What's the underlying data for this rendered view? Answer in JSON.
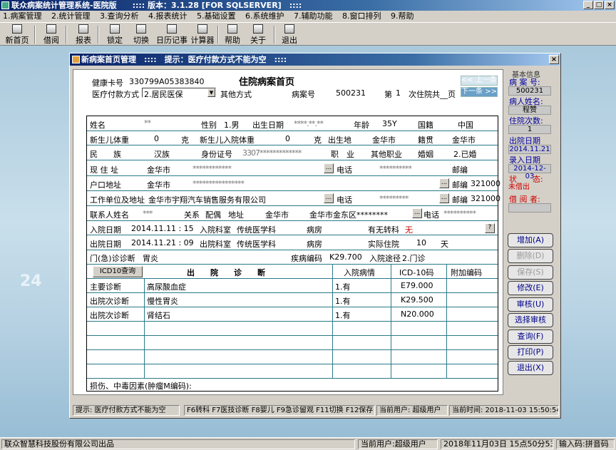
{
  "window": {
    "title": "联众病案统计管理系统-医院版　　:::: 版本：3.1.28 [FOR SQLSERVER]　::::"
  },
  "menu": [
    "1.病案管理",
    "2.统计管理",
    "3.查询分析",
    "4.报表统计",
    "5.基础设置",
    "6.系统维护",
    "7.辅助功能",
    "8.窗口排列",
    "9.帮助"
  ],
  "toolbar": [
    "新首页",
    "借阅",
    "报表",
    "锁定",
    "切换",
    "日历记事",
    "计算器",
    "帮助",
    "关于",
    "退出"
  ],
  "dialog": {
    "title": "新病案首页管理　::::　提示：医疗付款方式不能为空　::::",
    "close": "×",
    "health_card_label": "健康卡号",
    "health_card": "330799A05383840",
    "doc_title": "住院病案首页",
    "prev_btn": "<< 上一条",
    "next_btn": "下一条 >>",
    "pay_label": "医疗付款方式",
    "pay_value": "2.居民医保",
    "other_way_label": "其他方式",
    "case_no_label": "病案号",
    "case_no": "500231",
    "times_label": "第",
    "times": "1",
    "times_suffix": "次住院共__页",
    "name_label": "姓名",
    "name_value": "**",
    "sex_label": "性别",
    "sex_value": "1.男",
    "birth_label": "出生日期",
    "birth_value": "****.**.**",
    "age_label": "年龄",
    "age_value": "35Y",
    "nation_label": "国籍",
    "nation_value": "中国",
    "baby_weight_label": "新生儿体重",
    "baby_weight": "0",
    "unit_g": "克",
    "baby_in_weight_label": "新生儿入院体重",
    "baby_in_weight": "0",
    "unit_g2": "克",
    "birthplace_label": "出生地",
    "birthplace": "金华市",
    "native_label": "籍贯",
    "native": "金华市",
    "ethnic_label": "民　　族",
    "ethnic": "汉族",
    "id_label": "身份证号",
    "id_value": "3307*************",
    "job_label": "职　业",
    "job": "其他职业",
    "marriage_label": "婚姻",
    "marriage": "2.已婚",
    "cur_addr_label": "现 住 址",
    "cur_addr": "金华市",
    "cur_addr_blur": "************",
    "phone_label": "电话",
    "phone_blur": "**********",
    "zip_label": "邮编",
    "hukou_label": "户口地址",
    "hukou": "金华市",
    "hukou_blur": "****************",
    "zip_label2": "邮编",
    "zip2": "321000",
    "work_label": "工作单位及地址",
    "work": "金华市宇翔汽车销售服务有限公司",
    "phone_label2": "电话",
    "phone2_blur": "*********",
    "zip_label3": "邮编",
    "zip3": "321000",
    "contact_label": "联系人姓名",
    "contact_blur": "***",
    "relation_label": "关系",
    "relation": "配偶",
    "contact_addr_label": "地址",
    "contact_addr": "金华市",
    "contact_addr2": "金华市金东区********",
    "phone_label3": "电话",
    "phone3_blur": "**********",
    "in_date_label": "入院日期",
    "in_date": "2014.11.11 : 15",
    "in_dept_label": "入院科室",
    "in_dept": "传统医学科",
    "ward_label": "病房",
    "transfer_label": "有无转科",
    "transfer": "无",
    "help_q": "?",
    "out_date_label": "出院日期",
    "out_date": "2014.11.21 : 09",
    "out_dept_label": "出院科室",
    "out_dept": "传统医学科",
    "ward_label2": "病房",
    "stay_label": "实际住院",
    "stay": "10",
    "stay_unit": "天",
    "op_diag_label": "门(急)诊诊断",
    "op_diag": "胃炎",
    "disease_code_label": "疾病编码",
    "disease_code": "K29.700",
    "route_label": "入院途径",
    "route": "2.门诊",
    "icd_btn": "ICD10查询",
    "diag_header": [
      "出　　院　　诊　　断",
      "入院病情",
      "ICD-10码",
      "附加编码"
    ],
    "diagnoses": [
      {
        "type": "主要诊断",
        "name": "高尿酸血症",
        "cond": "1.有",
        "icd": "E79.000"
      },
      {
        "type": "出院次诊断",
        "name": "慢性胃炎",
        "cond": "1.有",
        "icd": "K29.500"
      },
      {
        "type": "出院次诊断",
        "name": "肾结石",
        "cond": "1.有",
        "icd": "N20.000"
      }
    ],
    "injury_label": "损伤、中毒因素(肿瘤M编码):"
  },
  "info": {
    "header": "基本信息",
    "case_label": "病 案 号:",
    "case": "500231",
    "name_label": "病人姓名:",
    "name": "程赞",
    "times_label": "住院次数:",
    "times": "1",
    "out_label": "出院日期",
    "out": "2014.11.21",
    "entry_label": "录入日期",
    "entry": "2014-12-03",
    "state_label": "状　　态:",
    "state": "未借出",
    "borrower_label": "借 阅 者:",
    "borrower": ""
  },
  "side_buttons": [
    "增加(A)",
    "删除(D)",
    "保存(S)",
    "修改(E)",
    "审核(U)",
    "选择审核",
    "查询(F)",
    "打印(P)",
    "退出(X)"
  ],
  "dialog_status": [
    "提示: 医疗付款方式不能为空",
    "F6转科 F7医技诊断 F8婴儿 F9急诊留观 F11切换 F12保存",
    "当前用户: 超级用户",
    "当前时间: 2018-11-03 15:50:54"
  ],
  "status": [
    "联众智慧科技股份有限公司出品",
    "当前用户:超级用户",
    "2018年11月03日 15点50分53秒",
    "输入码:拼音码"
  ]
}
